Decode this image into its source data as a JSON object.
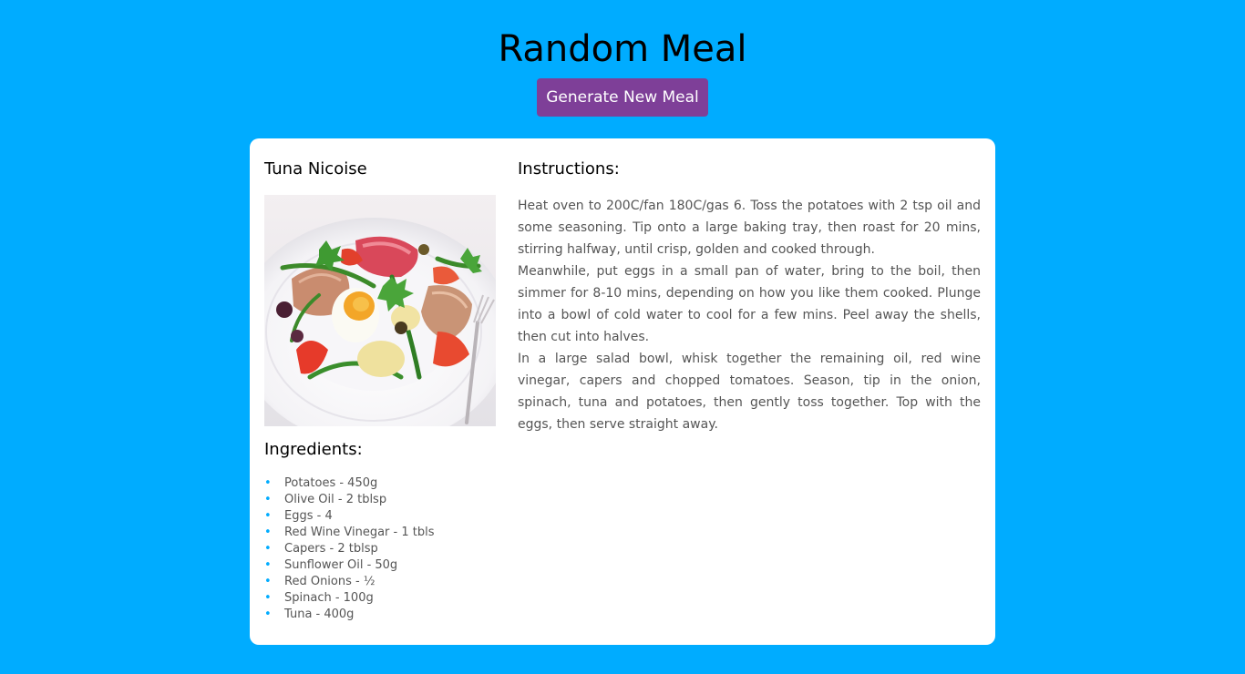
{
  "header": {
    "title": "Random Meal",
    "button_label": "Generate New Meal"
  },
  "meal": {
    "name": "Tuna Nicoise",
    "image_alt": "tuna-nicoise-photo",
    "ingredients_title": "Ingredients:",
    "ingredients": [
      "Potatoes - 450g",
      "Olive Oil - 2 tblsp",
      "Eggs - 4",
      "Red Wine Vinegar - 1 tbls",
      "Capers - 2 tblsp",
      "Sunflower Oil - 50g",
      "Red Onions - ½",
      "Spinach - 100g",
      "Tuna - 400g"
    ],
    "instructions_title": "Instructions:",
    "instructions": [
      "Heat oven to 200C/fan 180C/gas 6. Toss the potatoes with 2 tsp oil and some seasoning. Tip onto a large baking tray, then roast for 20 mins, stirring halfway, until crisp, golden and cooked through.",
      "Meanwhile, put eggs in a small pan of water, bring to the boil, then simmer for 8-10 mins, depending on how you like them cooked. Plunge into a bowl of cold water to cool for a few mins. Peel away the shells, then cut into halves.",
      "In a large salad bowl, whisk together the remaining oil, red wine vinegar, capers and chopped tomatoes. Season, tip in the onion, spinach, tuna and potatoes, then gently toss together. Top with the eggs, then serve straight away."
    ]
  },
  "colors": {
    "background": "#00acff",
    "button": "#7e3f98",
    "card": "#ffffff",
    "bullet": "#00acff",
    "body_text": "#555555"
  }
}
